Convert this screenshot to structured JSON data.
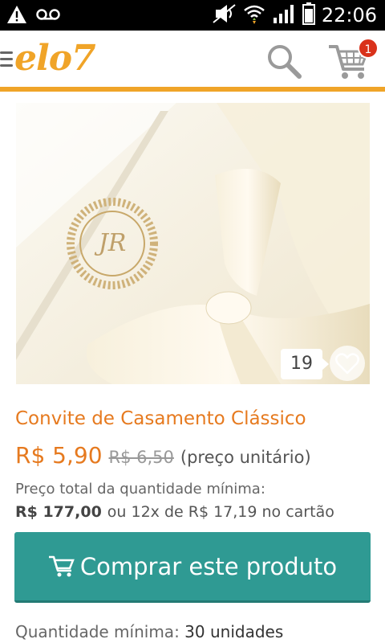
{
  "status_bar": {
    "time": "22:06",
    "icons": [
      "warning-icon",
      "voicemail-icon",
      "mute-icon",
      "wifi-icon",
      "signal-icon",
      "battery-icon"
    ]
  },
  "header": {
    "logo": "elo7",
    "search_icon": "search-icon",
    "cart_icon": "cart-icon",
    "cart_count": "1",
    "accent_color": "#f0a428"
  },
  "gallery": {
    "image_count": "19",
    "favorite_icon": "heart-icon"
  },
  "product": {
    "title": "Convite de Casamento Clássico",
    "price": "R$ 5,90",
    "old_price": "R$ 6,50",
    "unit_note": "(preço unitário)",
    "min_total_label": "Preço total da quantidade mínima:",
    "min_total_price": "R$ 177,00",
    "installment": "ou 12x de R$ 17,19 no cartão",
    "title_color": "#e67a1f"
  },
  "actions": {
    "buy_label": "Comprar este produto",
    "buy_color": "#2f9a93"
  },
  "quantity": {
    "label": "Quantidade mínima:",
    "value": "30 unidades"
  }
}
